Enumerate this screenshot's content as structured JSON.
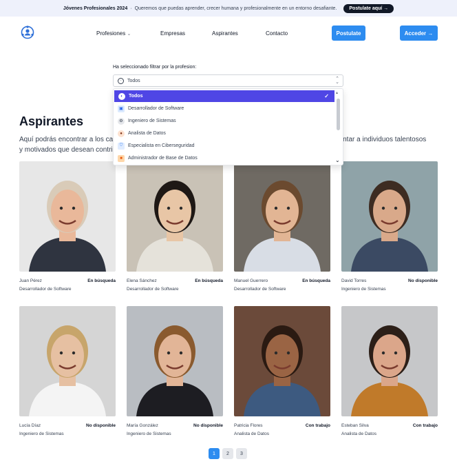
{
  "announcement": {
    "title": "Jóvenes Profesionales 2024",
    "separator": "·",
    "text": "Queremos que puedas aprender, crecer humana y profesionalmente en un entorno desafiante.",
    "cta": "Postulate aquí →"
  },
  "nav": {
    "links": [
      "Profesiones",
      "Empresas",
      "Aspirantes",
      "Contacto"
    ],
    "postulate": "Postulate",
    "login": "Acceder →"
  },
  "filter": {
    "label": "Ha seleccionado filtrar por la profesion:",
    "selected": "Todos",
    "options": [
      {
        "label": "Todos",
        "icon": "globe-icon",
        "selected": true
      },
      {
        "label": "Desarrollador de Software",
        "icon": "developer-icon",
        "selected": false
      },
      {
        "label": "Ingeniero de Sistemas",
        "icon": "engineer-icon",
        "selected": false
      },
      {
        "label": "Analista de Datos",
        "icon": "analyst-icon",
        "selected": false
      },
      {
        "label": "Especialista en Ciberseguridad",
        "icon": "shield-icon",
        "selected": false
      },
      {
        "label": "Administrador de Base de Datos",
        "icon": "database-icon",
        "selected": false
      }
    ]
  },
  "section": {
    "title": "Aspirantes",
    "intro_left": "Aquí podrás encontrar a los ca",
    "intro_right": "esentar a individuos talentosos",
    "intro_line2": "y motivados que desean contri"
  },
  "candidates": [
    {
      "name": "Juan Pérez",
      "status": "En búsqueda",
      "role": "Desarrollador de Software",
      "bg": "#e7e7e7",
      "skin": "#e9b89a",
      "hair": "#d9cbb8",
      "shirt": "#2f3440"
    },
    {
      "name": "Elena Sánchez",
      "status": "En búsqueda",
      "role": "Desarrollador de Software",
      "bg": "#c9c2b6",
      "skin": "#e8c6a6",
      "hair": "#1e1815",
      "shirt": "#e5e2da"
    },
    {
      "name": "Manuel Guerrero",
      "status": "En búsqueda",
      "role": "Desarrollador de Software",
      "bg": "#6f6a63",
      "skin": "#e2b594",
      "hair": "#6b4a2f",
      "shirt": "#d8dde5"
    },
    {
      "name": "David Torres",
      "status": "No disponible",
      "role": "Ingeniero de Sistemas",
      "bg": "#8fa3a8",
      "skin": "#d9a98a",
      "hair": "#3d2c22",
      "shirt": "#3b4a63"
    },
    {
      "name": "Lucía Díaz",
      "status": "No disponible",
      "role": "Ingeniero de Sistemas",
      "bg": "#d5d5d5",
      "skin": "#e6c0a2",
      "hair": "#c7a56b",
      "shirt": "#f4f4f4"
    },
    {
      "name": "María González",
      "status": "No disponible",
      "role": "Ingeniero de Sistemas",
      "bg": "#b9bdc2",
      "skin": "#e2b597",
      "hair": "#8a5a2e",
      "shirt": "#1d1d22"
    },
    {
      "name": "Patricia Flores",
      "status": "Con trabajo",
      "role": "Analista de Datos",
      "bg": "#6b4a3a",
      "skin": "#9a6444",
      "hair": "#2a1a12",
      "shirt": "#3d5a80"
    },
    {
      "name": "Esteban Silva",
      "status": "Con trabajo",
      "role": "Analista de Datos",
      "bg": "#c6c7c9",
      "skin": "#dba68a",
      "hair": "#2c1f18",
      "shirt": "#c07a2a"
    }
  ],
  "pagination": [
    "1",
    "2",
    "3"
  ],
  "colors": {
    "accent": "#2d8cf0",
    "selected_option": "#4f46e5"
  }
}
